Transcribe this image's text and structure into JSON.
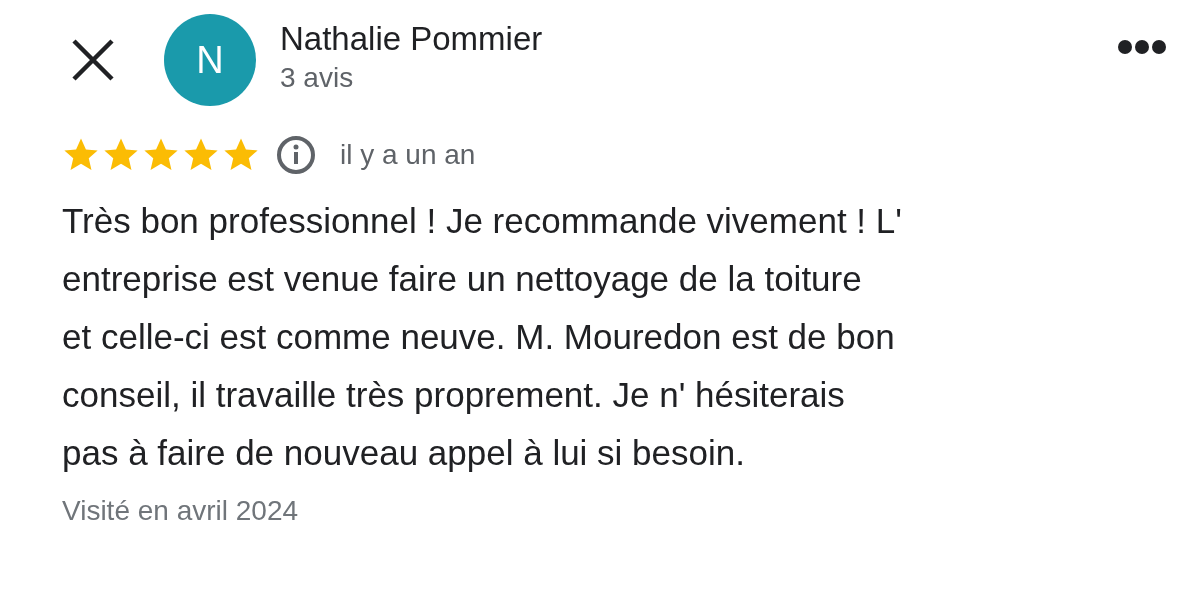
{
  "reviewer": {
    "initial": "N",
    "name": "Nathalie Pommier",
    "review_count": "3 avis"
  },
  "review": {
    "stars": 5,
    "time": "il y a un an",
    "lines": [
      "Très bon professionnel ! Je recommande vivement ! L'",
      "entreprise est venue faire un nettoyage de la toiture",
      "et celle-ci est comme neuve. M. Mouredon est de bon",
      "conseil, il travaille très proprement. Je n' hésiterais",
      "pas à faire de nouveau appel à lui si besoin."
    ],
    "visited": "Visité en avril 2024"
  }
}
